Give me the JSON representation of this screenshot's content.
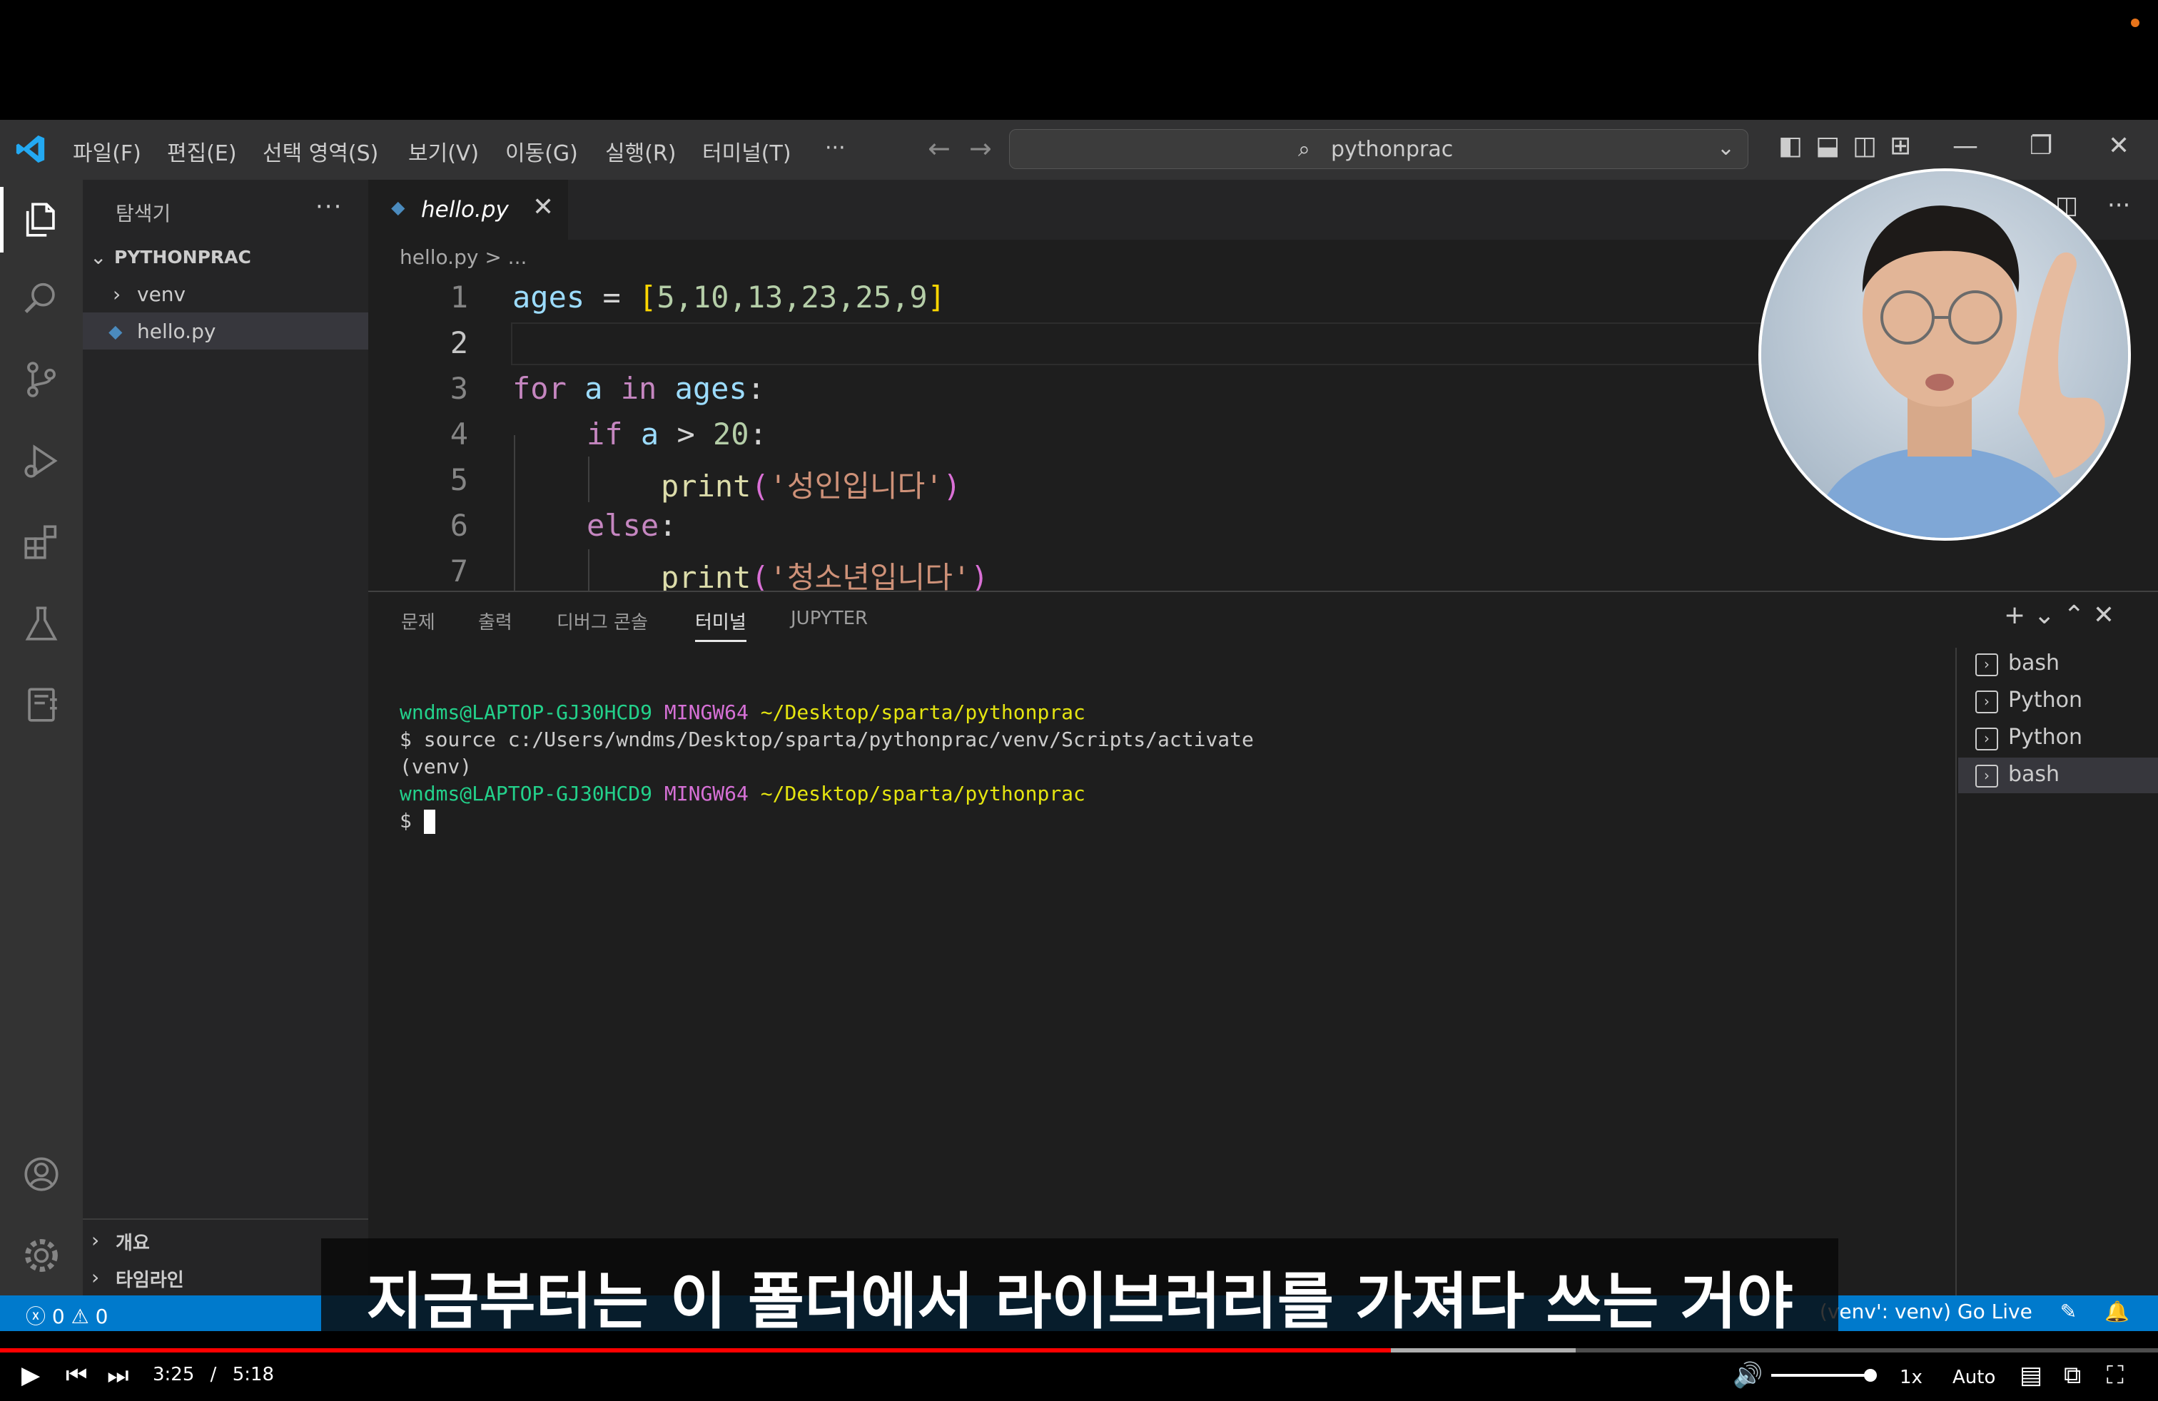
{
  "menu": {
    "items": [
      "파일(F)",
      "편집(E)",
      "선택 영역(S)",
      "보기(V)",
      "이동(G)",
      "실행(R)",
      "터미널(T)",
      "···"
    ]
  },
  "command_center": {
    "label": "pythonprac"
  },
  "sidebar": {
    "title": "탐색기",
    "more": "···",
    "root_folder": "PYTHONPRAC",
    "items": [
      {
        "label": "venv",
        "kind": "folder",
        "icon": "chevron-right-icon"
      },
      {
        "label": "hello.py",
        "kind": "python-file",
        "icon": "python-icon"
      }
    ],
    "bottom_sections": [
      "개요",
      "타임라인"
    ]
  },
  "editor": {
    "tab": {
      "label": "hello.py",
      "close": "✕"
    },
    "breadcrumb": "hello.py > ...",
    "lines": [
      {
        "num": "1"
      },
      {
        "num": "2"
      },
      {
        "num": "3"
      },
      {
        "num": "4"
      },
      {
        "num": "5"
      },
      {
        "num": "6"
      },
      {
        "num": "7"
      }
    ],
    "code": {
      "l1_var": "ages",
      "l1_eq": " = ",
      "l1_open": "[",
      "l1_values": "5,10,13,23,25,9",
      "l1_close": "]",
      "l3_for": "for",
      "l3_a": " a ",
      "l3_in": "in",
      "l3_ages": " ages",
      "l3_colon": ":",
      "l4_if": "if",
      "l4_a": " a ",
      "l4_gt": "> ",
      "l4_num": "20",
      "l4_colon": ":",
      "l5_print": "print",
      "l5_open": "(",
      "l5_str": "'성인입니다'",
      "l5_close": ")",
      "l6_else": "else",
      "l6_colon": ":",
      "l7_print": "print",
      "l7_open": "(",
      "l7_str": "'청소년입니다'",
      "l7_close": ")"
    }
  },
  "panel": {
    "tabs": [
      "문제",
      "출력",
      "디버그 콘솔",
      "터미널",
      "JUPYTER"
    ],
    "active_tab": "터미널",
    "actions": "+ ⌄  ⌃  ✕",
    "terminal": {
      "l1_user": "wndms@LAPTOP-GJ30HCD9",
      "l1_sys": "MINGW64",
      "l1_path": "~/Desktop/sparta/pythonprac",
      "l2": "$ source c:/Users/wndms/Desktop/sparta/pythonprac/venv/Scripts/activate",
      "l3": "(venv)",
      "l4_user": "wndms@LAPTOP-GJ30HCD9",
      "l4_sys": "MINGW64",
      "l4_path": "~/Desktop/sparta/pythonprac",
      "l5_prompt": "$ "
    },
    "terminal_list": [
      "bash",
      "Python",
      "Python",
      "bash"
    ]
  },
  "statusbar": {
    "problems": "ⓧ 0 ⚠ 0",
    "right": "(venv': venv)   Go Live"
  },
  "subtitle": "지금부터는 이 폴더에서 라이브러리를 가져다 쓰는 거야",
  "player": {
    "current_time": "3:25",
    "separator": "/",
    "duration": "5:18",
    "progress": 0.6444,
    "buffered": 0.73,
    "speed": "1x",
    "quality": "Auto"
  },
  "colors": {
    "statusbar": "#007acc",
    "progress": "#ff0000",
    "keyword": "#c586c0",
    "string": "#ce9178"
  }
}
